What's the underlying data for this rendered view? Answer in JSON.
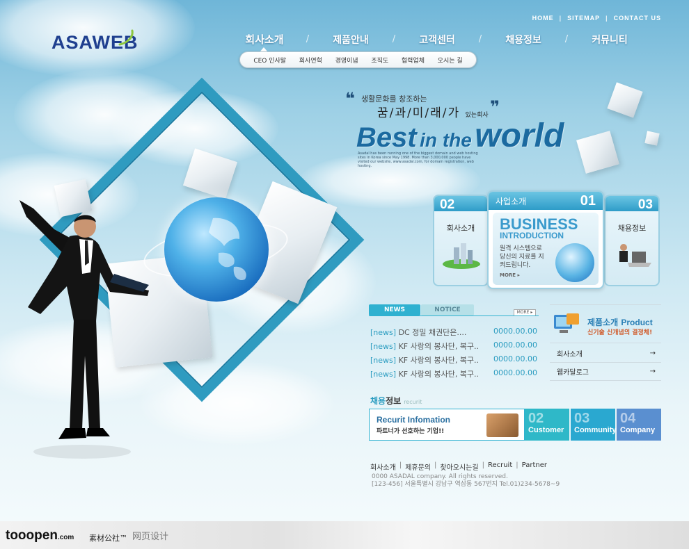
{
  "header": {
    "logo": "ASAWEB",
    "top_links": [
      "HOME",
      "SITEMAP",
      "CONTACT US"
    ],
    "gnb": [
      "회사소개",
      "제품안내",
      "고객센터",
      "채용정보",
      "커뮤니티"
    ],
    "sub_nav": [
      "CEO 인사말",
      "회사연혁",
      "경영이념",
      "조직도",
      "협력업체",
      "오시는 길"
    ]
  },
  "hero": {
    "quote_open": "❝",
    "quote_close": "❞",
    "line1": "생활문화를 창조하는",
    "line2": "꿈/과/미/래/가",
    "line2_suffix": "있는회사",
    "headline_1": "Best",
    "headline_2": "in the",
    "headline_3": "world",
    "small_text": "Asadal has been running one of the biggest domain and web hosting sites in Korea since May 1998. More than 3,000,000 people have visited our website, www.asadal.com, for domain registration, web hosting."
  },
  "cards": {
    "left": {
      "num": "02",
      "label": "회사소개"
    },
    "main": {
      "tab": "사업소개",
      "num": "01",
      "title": "BUSINESS",
      "subtitle": "INTRODUCTION",
      "text": "원격 시스템으로 당신의 지료를 지켜드립니다.",
      "more": "MORE ▸"
    },
    "right": {
      "num": "03",
      "label": "채용정보"
    }
  },
  "news": {
    "tab_news": "NEWS",
    "tab_notice": "NOTICE",
    "more": "MORE ▸",
    "items": [
      {
        "tag": "[news]",
        "title": "DC 정밀 채권단은....",
        "date": "0000.00.00"
      },
      {
        "tag": "[news]",
        "title": "KF 사랑의 봉사단, 복구..",
        "date": "0000.00.00"
      },
      {
        "tag": "[news]",
        "title": "KF 사랑의 봉사단, 복구..",
        "date": "0000.00.00"
      },
      {
        "tag": "[news]",
        "title": "KF 사랑의 봉사단, 복구..",
        "date": "0000.00.00"
      }
    ]
  },
  "product": {
    "title_ko": "제품소개",
    "title_en": "Product",
    "subtitle": "신기술 신개념의 결정체!",
    "links": [
      "회사소개",
      "웹카달로그"
    ],
    "arrow": "→"
  },
  "recruit": {
    "title_a": "채용",
    "title_b": "정보",
    "title_small": "recurit",
    "box_title": "Recurit Infomation",
    "box_sub": "파트너가 선호하는 기업!!"
  },
  "quick": [
    {
      "num": "02",
      "label": "Customer",
      "color": "#2fb8c8"
    },
    {
      "num": "03",
      "label": "Community",
      "color": "#2aa8d0"
    },
    {
      "num": "04",
      "label": "Company",
      "color": "#5a8fd0"
    }
  ],
  "footer": {
    "links": [
      "회사소개",
      "제휴문의",
      "찾아오시는길",
      "Recruit",
      "Partner"
    ],
    "copyright": "0000 ASADAL company. All rights reserved.",
    "address": "[123-456] 서울특별시 강남구 역삼동 567번지 Tel.01)234-5678~9"
  },
  "watermark": {
    "brand": "tooopen",
    "brand_suffix": ".com",
    "cn": "素材公社™",
    "cn2": "网页设计"
  },
  "colors": {
    "accent": "#2fb1d0",
    "brand": "#1f3f8f",
    "sky": "#9fd1e6"
  }
}
